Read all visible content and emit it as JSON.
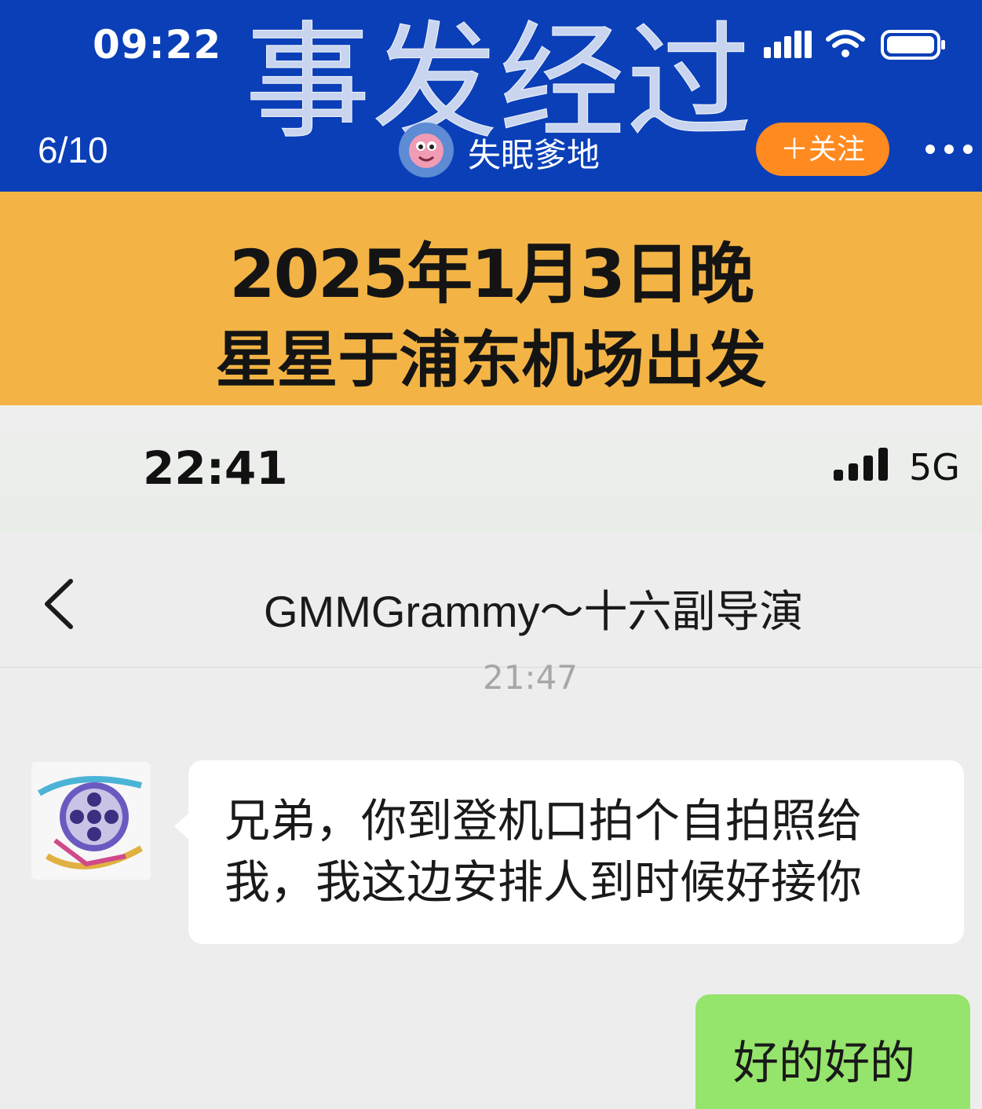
{
  "status_bar": {
    "time": "09:22"
  },
  "overlay_title": "事发经过",
  "post_header": {
    "page_counter": "6/10",
    "author_name": "失眠爹地",
    "follow_label": "＋关注"
  },
  "banner": {
    "line1": "2025年1月3日晚",
    "line2": "星星于浦东机场出发"
  },
  "chat": {
    "status_bar": {
      "time": "22:41",
      "network": "5G"
    },
    "title": "GMMGrammy～十六副导演",
    "timestamp": "21:47",
    "messages": [
      {
        "side": "left",
        "text": "兄弟，你到登机口拍个自拍照给我，我这边安排人到时候好接你"
      },
      {
        "side": "right",
        "text": "好的好的"
      }
    ]
  },
  "colors": {
    "header_blue": "#0a3fb8",
    "banner_orange": "#f3b445",
    "follow_orange": "#ff8a1f",
    "bubble_green": "#95e46b"
  }
}
